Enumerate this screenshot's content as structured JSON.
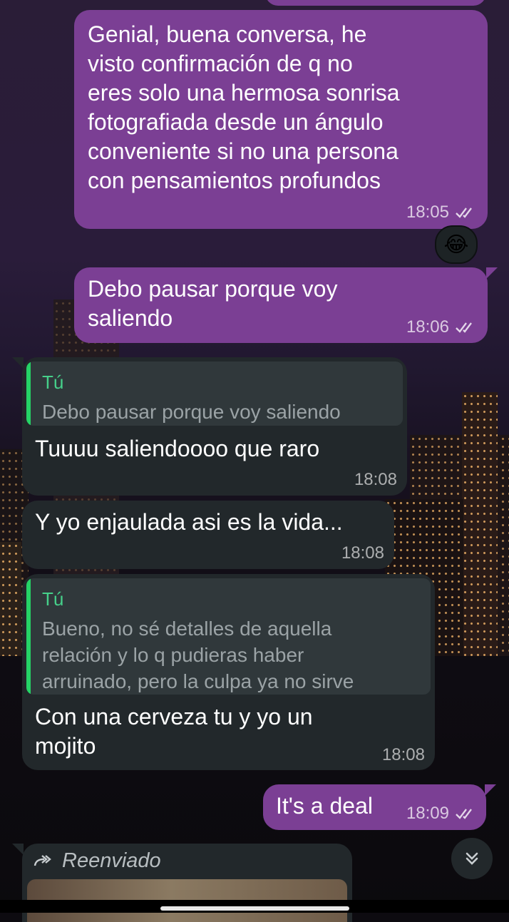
{
  "colors": {
    "outgoing_bubble": "#7b3f94",
    "incoming_bubble": "#22282b",
    "quote_accent": "#25d366",
    "quote_author": "#46d08a"
  },
  "messages": [
    {
      "direction": "outgoing",
      "text": "Genial, buena conversa, he\nvisto confirmación de q no\neres solo una hermosa sonrisa\nfotografiada desde un ángulo\nconveniente si no una persona\ncon pensamientos profundos",
      "time": "18:05",
      "status": "read-double-check-icon",
      "reaction": "😂"
    },
    {
      "direction": "outgoing",
      "text": "Debo pausar porque voy\nsaliendo",
      "time": "18:06",
      "status": "read-double-check-icon"
    },
    {
      "direction": "incoming",
      "quote": {
        "author": "Tú",
        "text": "Debo pausar porque voy saliendo"
      },
      "text": "Tuuuu saliendoooo que raro",
      "time": "18:08"
    },
    {
      "direction": "incoming",
      "text": "Y yo enjaulada asi es la vida...",
      "time": "18:08"
    },
    {
      "direction": "incoming",
      "quote": {
        "author": "Tú",
        "text": "Bueno, no sé detalles de aquella\nrelación y lo q pudieras haber\narruinado, pero la culpa ya no sirve"
      },
      "text": "Con una cerveza tu y yo un\nmojito",
      "time": "18:08"
    },
    {
      "direction": "outgoing",
      "text": "It's a deal",
      "time": "18:09",
      "status": "read-double-check-icon"
    },
    {
      "direction": "incoming",
      "forwarded_label": "Reenviado",
      "forwarded_icon": "forward-arrow-icon"
    }
  ],
  "scroll_button_icon": "double-chevron-down-icon"
}
